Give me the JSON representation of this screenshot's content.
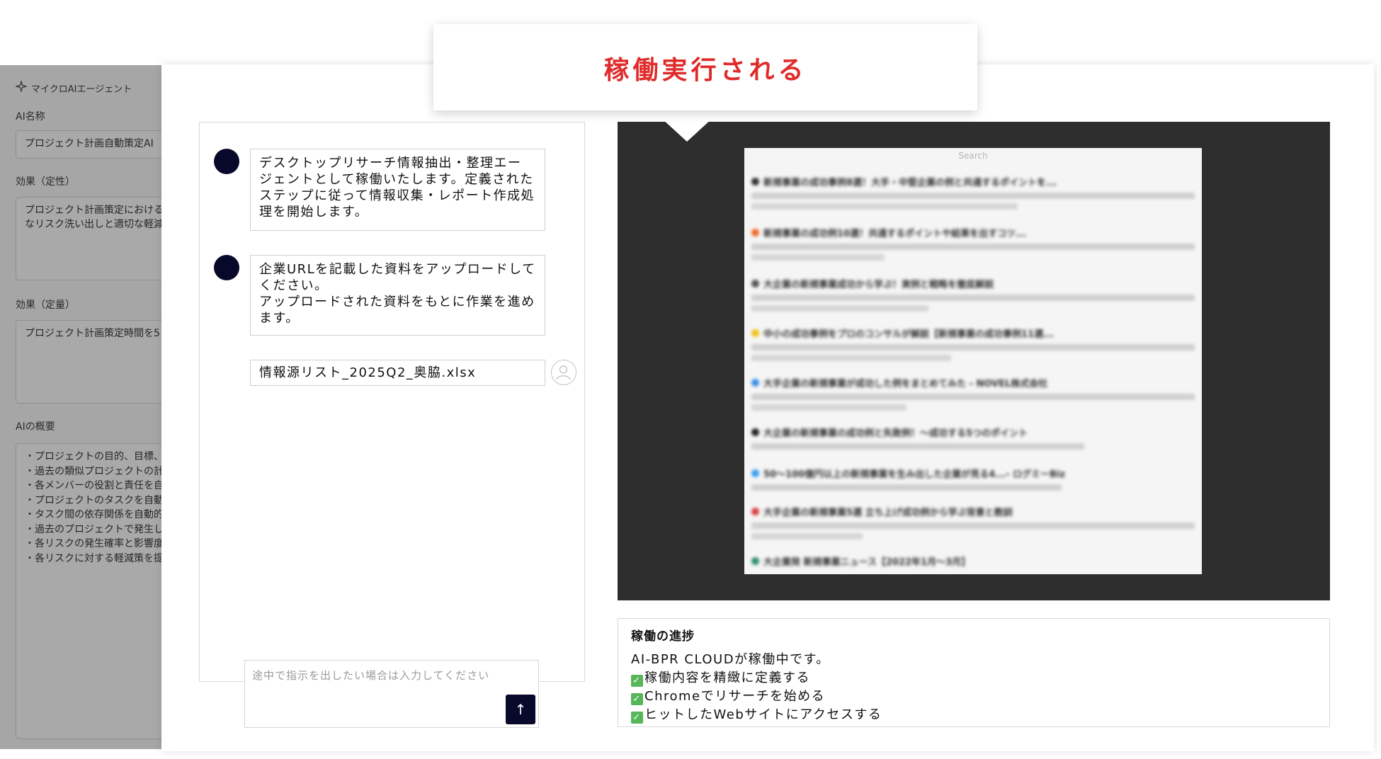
{
  "left_panel": {
    "header": "マイクロAIエージェント",
    "ai_name_label": "AI名称",
    "ai_name_value": "プロジェクト計画自動策定AI",
    "qual_label": "効果（定性）",
    "qual_lines": [
      "プロジェクト計画策定における",
      "なリスク洗い出しと適切な軽減"
    ],
    "quant_label": "効果（定量）",
    "quant_value": "プロジェクト計画策定時間を5",
    "overview_label": "AIの概要",
    "overview_lines": [
      "・プロジェクトの目的、目標、",
      "・過去の類似プロジェクトの計",
      "・各メンバーの役割と責任を自",
      "・プロジェクトのタスクを自動",
      "・タスク間の依存関係を自動的",
      "・過去のプロジェクトで発生し",
      "・各リスクの発生確率と影響度",
      "・各リスクに対する軽減策を提"
    ]
  },
  "banner": {
    "text": "稼働実行される"
  },
  "chat": {
    "messages": [
      {
        "lines": [
          "デスクトップリサーチ情報抽出・整理エー",
          "ジェントとして稼働いたします。定義された",
          "ステップに従って情報収集・レポート作成処",
          "理を開始します。"
        ]
      },
      {
        "lines": [
          "企業URLを記載した資料をアップロードして",
          "ください。",
          "アップロードされた資料をもとに作業を進め",
          "ます。"
        ]
      }
    ],
    "file": "情報源リスト_2025Q2_奥脇.xlsx",
    "input_placeholder": "途中で指示を出したい場合は入力してください",
    "send_icon": "↑"
  },
  "browser": {
    "search_label": "Search",
    "results": [
      {
        "title": "新規事業の成功事例8選！大手・中堅企業の例と共通するポイントを...",
        "color": "#333333"
      },
      {
        "title": "新規事業の成功例10選！共通するポイントや結果を出すコツ...",
        "color": "#f06a2a"
      },
      {
        "title": "大企業の新規事業成功から学ぶ！実例と戦略を徹底解説",
        "color": "#555555"
      },
      {
        "title": "中小の成功事例をプロのコンサルが解説【新規事業の成功事例11選...",
        "color": "#f2c21b"
      },
      {
        "title": "大手企業の新規事業が成功した例をまとめてみた - NOVEL株式会社",
        "color": "#3a8ee6"
      },
      {
        "title": "大企業の新規事業の成功例と失敗例！〜成功する5つのポイント",
        "color": "#222222"
      },
      {
        "title": "50〜100億円以上の新規事業を生み出した企業が見る4...- ログミーBiz",
        "color": "#3a9ff0"
      },
      {
        "title": "大手企業の新規事業5選 立ち上げ成功例から学ぶ背景と教訓",
        "color": "#d94040"
      },
      {
        "title": "大企業発 新規事業ニュース【2022年1月〜3月】",
        "color": "#2e8f6a"
      }
    ]
  },
  "progress": {
    "title": "稼働の進捗",
    "status": "AI-BPR CLOUDが稼働中です。",
    "check_icon": "✓",
    "steps": [
      "稼働内容を精緻に定義する",
      "Chromeでリサーチを始める",
      "ヒットしたWebサイトにアクセスする"
    ]
  }
}
